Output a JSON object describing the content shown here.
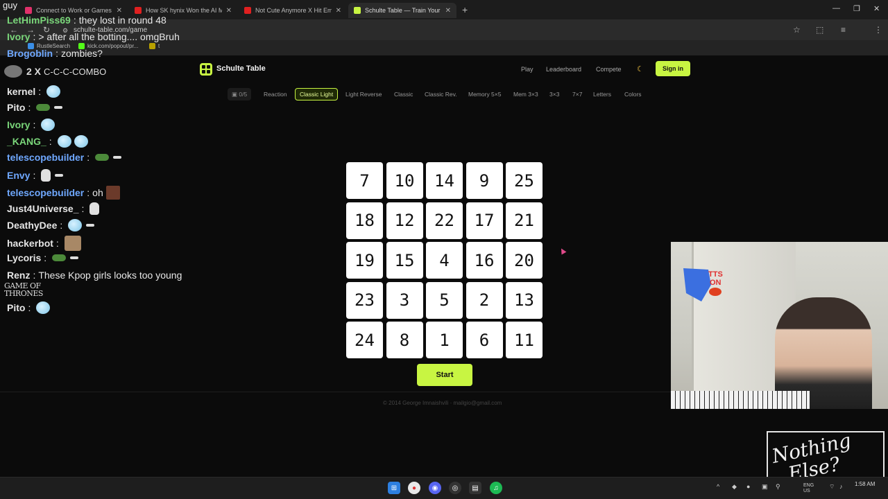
{
  "browser": {
    "tabs": [
      {
        "title": "Connect to Work or Games fro",
        "color": "#e0316a"
      },
      {
        "title": "How SK hynix Won the AI Mem",
        "color": "#e02020"
      },
      {
        "title": "Not Cute Anymore X Hit Em Up",
        "color": "#e02020"
      },
      {
        "title": "Schulte Table — Train Your Focu",
        "color": "#c8f542"
      }
    ],
    "new_tab": "+",
    "url": "schulte-table.com/game",
    "bookmarks": [
      {
        "label": "RustleSearch",
        "color": "#3a8ee6"
      },
      {
        "label": "kick.com/popout/pr...",
        "color": "#53fc18"
      },
      {
        "label": "t",
        "color": "#b8a000"
      }
    ],
    "window_controls": [
      "—",
      "❐",
      "✕"
    ]
  },
  "site": {
    "brand": "Schulte Table",
    "nav": [
      "Play",
      "Leaderboard",
      "Compete"
    ],
    "theme_icon": "☾",
    "signin": "Sign in",
    "progress_badge": "0/5",
    "modes": [
      "Reaction",
      "Classic Light",
      "Light Reverse",
      "Classic",
      "Classic Rev.",
      "Memory 5×5",
      "Mem 3×3",
      "3×3",
      "7×7",
      "Letters",
      "Colors"
    ],
    "selected_mode": "Classic Light",
    "grid": [
      "7",
      "10",
      "14",
      "9",
      "25",
      "18",
      "12",
      "22",
      "17",
      "21",
      "19",
      "15",
      "4",
      "16",
      "20",
      "23",
      "3",
      "5",
      "2",
      "13",
      "24",
      "8",
      "1",
      "6",
      "11"
    ],
    "start": "Start",
    "footer": "© 2014 George Imnaishvili · mailgio@gmail.com",
    "accent": "#c8f542"
  },
  "overlay": {
    "corner_label": "guy",
    "messages_top": [
      {
        "user": "LetHimPiss69",
        "text": "they lost in round 48",
        "color": "#7ad67a"
      },
      {
        "user": "Ivory",
        "text": "> after all the botting.... omgBruh",
        "color": "#7ad67a"
      },
      {
        "user": "Brogoblin",
        "text": "zombies?",
        "color": "#6fa8ff"
      }
    ],
    "combo_count": "2 X",
    "combo_text": "C-C-C-COMBO",
    "messages": [
      {
        "user": "kernel",
        "text": "",
        "color": "#e6e6e6",
        "emotes": [
          "ice"
        ]
      },
      {
        "user": "Pito",
        "text": "",
        "color": "#e6e6e6",
        "emotes": [
          "frog",
          "small"
        ]
      },
      {
        "user": "Ivory",
        "text": "",
        "color": "#7ad67a",
        "emotes": [
          "ice"
        ]
      },
      {
        "user": "_KANG_",
        "text": "",
        "color": "#7ad67a",
        "emotes": [
          "ice",
          "ice"
        ]
      },
      {
        "user": "telescopebuilder",
        "text": "",
        "color": "#6fa8ff",
        "emotes": [
          "frog",
          "small"
        ]
      },
      {
        "user": "Envy",
        "text": "",
        "color": "#6fa8ff",
        "emotes": [
          "skull",
          "small"
        ]
      },
      {
        "user": "telescopebuilder",
        "text": "oh",
        "color": "#6fa8ff",
        "emotes": [
          "face"
        ]
      },
      {
        "user": "Just4Universe_",
        "text": "",
        "color": "#e6e6e6",
        "emotes": [
          "skull"
        ]
      },
      {
        "user": "DeathyDee",
        "text": "",
        "color": "#e6e6e6",
        "emotes": [
          "ice",
          "small"
        ]
      },
      {
        "user": "hackerbot",
        "text": "",
        "color": "#e6e6e6",
        "emotes": [
          "cat"
        ]
      },
      {
        "user": "Lycoris",
        "text": "",
        "color": "#e6e6e6",
        "emotes": [
          "frog",
          "small"
        ]
      },
      {
        "user": "Renz",
        "text": "These Kpop girls looks too young",
        "color": "#e6e6e6",
        "emotes": []
      }
    ],
    "got_logo": "GAME OF THRONES",
    "last_message": {
      "user": "Pito",
      "text": "",
      "color": "#e6e6e6",
      "emotes": [
        "ice"
      ]
    },
    "watermark": "Nothing Else?",
    "tts_label": "TTS ON"
  },
  "taskbar": {
    "tray_lang": "ENG US",
    "time": "1:58 AM"
  }
}
